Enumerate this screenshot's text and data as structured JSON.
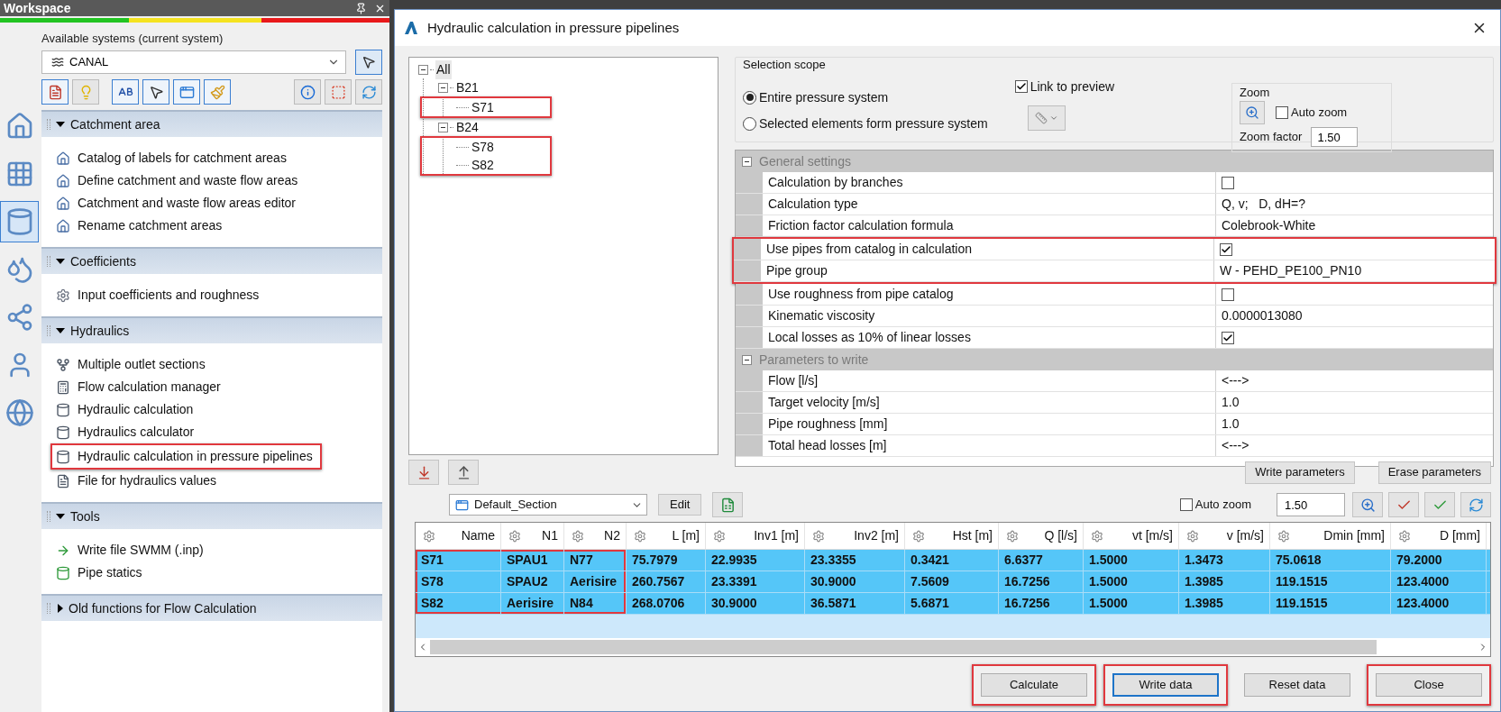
{
  "workspace": {
    "title": "Workspace",
    "systems_label": "Available systems (current system)",
    "system": "CANAL",
    "side_tabs": [
      {
        "selected": false
      },
      {
        "selected": false
      },
      {
        "selected": true
      },
      {
        "selected": false
      },
      {
        "selected": false
      },
      {
        "selected": false
      },
      {
        "selected": false
      }
    ],
    "sections": [
      {
        "title": "Catchment area",
        "expanded": true,
        "items": [
          {
            "label": "Catalog of labels for catchment areas",
            "annotated": false
          },
          {
            "label": "Define catchment and waste flow areas",
            "annotated": false
          },
          {
            "label": "Catchment and waste flow areas editor",
            "annotated": false
          },
          {
            "label": "Rename catchment areas",
            "annotated": false
          }
        ]
      },
      {
        "title": "Coefficients",
        "expanded": true,
        "items": [
          {
            "label": "Input coefficients and roughness",
            "annotated": false
          }
        ]
      },
      {
        "title": "Hydraulics",
        "expanded": true,
        "items": [
          {
            "label": "Multiple outlet sections",
            "annotated": false
          },
          {
            "label": "Flow calculation manager",
            "annotated": false
          },
          {
            "label": "Hydraulic calculation",
            "annotated": false
          },
          {
            "label": "Hydraulics calculator",
            "annotated": false
          },
          {
            "label": "Hydraulic calculation in pressure pipelines",
            "annotated": true
          },
          {
            "label": "File for hydraulics values",
            "annotated": false
          }
        ]
      },
      {
        "title": "Tools",
        "expanded": true,
        "items": [
          {
            "label": "Write file SWMM (.inp)",
            "annotated": false
          },
          {
            "label": "Pipe statics",
            "annotated": false
          }
        ]
      },
      {
        "title": "Old functions for Flow Calculation",
        "expanded": false
      }
    ]
  },
  "dialog": {
    "title": "Hydraulic calculation in pressure pipelines",
    "tree": {
      "label": "All",
      "expanded": true,
      "children_annotated": false,
      "children": [
        {
          "label": "B21",
          "expanded": true,
          "children_annotated": true,
          "children": [
            {
              "label": "S71"
            }
          ]
        },
        {
          "label": "B24",
          "expanded": true,
          "children_annotated": true,
          "children": [
            {
              "label": "S78"
            },
            {
              "label": "S82"
            }
          ]
        }
      ]
    },
    "selection_scope": {
      "title": "Selection scope",
      "options": [
        {
          "label": "Entire pressure system",
          "selected": true
        },
        {
          "label": "Selected elements form pressure system",
          "selected": false
        }
      ],
      "link_to_preview": {
        "label": "Link to preview",
        "checked": true
      }
    },
    "zoom": {
      "title": "Zoom",
      "auto_zoom": {
        "label": "Auto zoom",
        "checked": false
      },
      "factor_label": "Zoom factor",
      "factor": "1.50"
    },
    "property_groups": [
      {
        "title": "General settings",
        "expanded": true,
        "rows": [
          {
            "label": "Calculation by branches",
            "kind": "checkbox",
            "checked": false,
            "annotated": false
          },
          {
            "label": "Calculation type",
            "kind": "text",
            "value": "Q, v;   D, dH=?",
            "annotated": false
          },
          {
            "label": "Friction factor calculation formula",
            "kind": "text",
            "value": "Colebrook-White",
            "annotated": false
          },
          {
            "label": "Use pipes from catalog in calculation",
            "kind": "checkbox",
            "checked": true,
            "annotated": true
          },
          {
            "label": "Pipe group",
            "kind": "text",
            "value": "W - PEHD_PE100_PN10",
            "annotated": true
          },
          {
            "label": "Use roughness from pipe catalog",
            "kind": "checkbox",
            "checked": false,
            "annotated": false
          },
          {
            "label": "Kinematic viscosity",
            "kind": "text",
            "value": "0.0000013080",
            "annotated": false
          },
          {
            "label": "Local losses as 10% of linear losses",
            "kind": "checkbox",
            "checked": true,
            "annotated": false
          }
        ]
      },
      {
        "title": "Parameters to write",
        "expanded": true,
        "rows": [
          {
            "label": "Flow [l/s]",
            "kind": "text",
            "value": "<--->",
            "annotated": false
          },
          {
            "label": "Target velocity [m/s]",
            "kind": "text",
            "value": "1.0",
            "annotated": false
          },
          {
            "label": "Pipe roughness [mm]",
            "kind": "text",
            "value": "1.0",
            "annotated": false
          },
          {
            "label": "Total head losses [m]",
            "kind": "text",
            "value": "<--->",
            "annotated": false
          }
        ]
      }
    ],
    "parameter_buttons": [
      "Write parameters",
      "Erase parameters"
    ],
    "section": {
      "value": "Default_Section",
      "edit": "Edit"
    },
    "table_zoom": {
      "auto_zoom": {
        "label": "Auto zoom",
        "checked": false
      },
      "factor": "1.50"
    },
    "table": {
      "columns": [
        {
          "label": "Name",
          "annotated": true
        },
        {
          "label": "N1",
          "annotated": true
        },
        {
          "label": "N2",
          "annotated": true
        },
        {
          "label": "L [m]",
          "annotated": false
        },
        {
          "label": "Inv1 [m]",
          "annotated": false
        },
        {
          "label": "Inv2 [m]",
          "annotated": false
        },
        {
          "label": "Hst [m]",
          "annotated": false
        },
        {
          "label": "Q [l/s]",
          "annotated": false
        },
        {
          "label": "vt [m/s]",
          "annotated": false
        },
        {
          "label": "v [m/s]",
          "annotated": false
        },
        {
          "label": "Dmin [mm]",
          "annotated": false
        },
        {
          "label": "D [mm]",
          "annotated": false
        }
      ],
      "rows": [
        {
          "selected": true,
          "cells": [
            "S71",
            "SPAU1",
            "N77",
            "75.7979",
            "22.9935",
            "23.3355",
            "0.3421",
            "6.6377",
            "1.5000",
            "1.3473",
            "75.0618",
            "79.2000"
          ]
        },
        {
          "selected": true,
          "cells": [
            "S78",
            "SPAU2",
            "Aerisire",
            "260.7567",
            "23.3391",
            "30.9000",
            "7.5609",
            "16.7256",
            "1.5000",
            "1.3985",
            "119.1515",
            "123.4000"
          ]
        },
        {
          "selected": true,
          "cells": [
            "S82",
            "Aerisire",
            "N84",
            "268.0706",
            "30.9000",
            "36.5871",
            "5.6871",
            "16.7256",
            "1.5000",
            "1.3985",
            "119.1515",
            "123.4000"
          ]
        }
      ]
    },
    "buttons": [
      {
        "label": "Calculate",
        "annotated": true,
        "focused": false
      },
      {
        "label": "Write data",
        "annotated": true,
        "focused": true
      },
      {
        "label": "Reset data",
        "annotated": false,
        "focused": false
      },
      {
        "label": "Close",
        "annotated": true,
        "focused": false
      }
    ]
  }
}
